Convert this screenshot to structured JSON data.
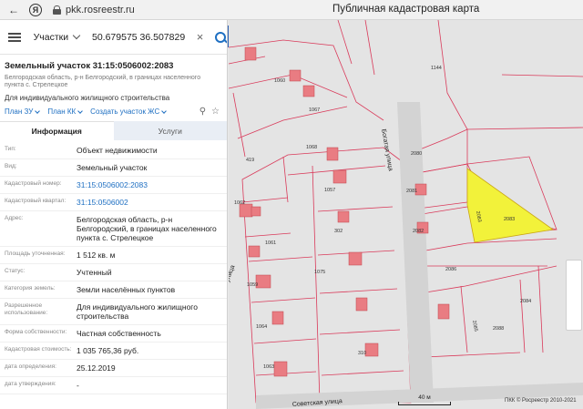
{
  "browser": {
    "back_icon": "arrow-left-icon",
    "yandex_icon": "Я",
    "url": "pkk.rosreestr.ru",
    "page_title": "Публичная кадастровая карта"
  },
  "search": {
    "mode_label": "Участки",
    "query": "50.679575 36.507829",
    "clear_icon": "close-icon",
    "search_icon": "search-icon"
  },
  "parcel": {
    "title": "Земельный участок 31:15:0506002:2083",
    "address_line": "Белгородская область, р-н Белгородский, в границах населенного пункта с. Стрелецкое",
    "use": "Для индивидуального жилищного строительства",
    "links": [
      "План ЗУ",
      "План КК",
      "Создать участок ЖС"
    ]
  },
  "tabs": {
    "info": "Информация",
    "services": "Услуги"
  },
  "rows": [
    {
      "k": "Тип:",
      "v": "Объект недвижимости"
    },
    {
      "k": "Вид:",
      "v": "Земельный участок"
    },
    {
      "k": "Кадастровый номер:",
      "v": "31:15:0506002:2083",
      "link": true
    },
    {
      "k": "Кадастровый квартал:",
      "v": "31:15:0506002",
      "link": true
    },
    {
      "k": "Адрес:",
      "v": "Белгородская область, р-н Белгородский, в границах населенного пункта с. Стрелецкое"
    },
    {
      "k": "Площадь уточненная:",
      "v": "1 512 кв. м"
    },
    {
      "k": "Статус:",
      "v": "Учтенный"
    },
    {
      "k": "Категория земель:",
      "v": "Земли населённых пунктов"
    },
    {
      "k": "Разрешенное использование:",
      "v": "Для индивидуального жилищного строительства"
    },
    {
      "k": "Форма собственности:",
      "v": "Частная собственность"
    },
    {
      "k": "Кадастровая стоимость:",
      "v": "1 035 765,36 руб."
    },
    {
      "k": "дата определения:",
      "v": "25.12.2019"
    },
    {
      "k": "дата утверждения:",
      "v": "-"
    }
  ],
  "map": {
    "parcel_labels": [
      "1060",
      "1067",
      "1068",
      "1057",
      "1062",
      "302",
      "1061",
      "1075",
      "1059",
      "1064",
      "310",
      "1063",
      "419",
      "1144",
      "2080",
      "2081",
      "2082",
      "2083",
      "2083",
      "2086",
      "2084",
      "2085",
      "2088"
    ],
    "streets": [
      "Богатая улица",
      "Советская улица",
      "улица"
    ],
    "scale_label": "40 м",
    "copyright": "ПКК © Росреестр 2010-2021",
    "highlight_color": "#f2f23a"
  }
}
